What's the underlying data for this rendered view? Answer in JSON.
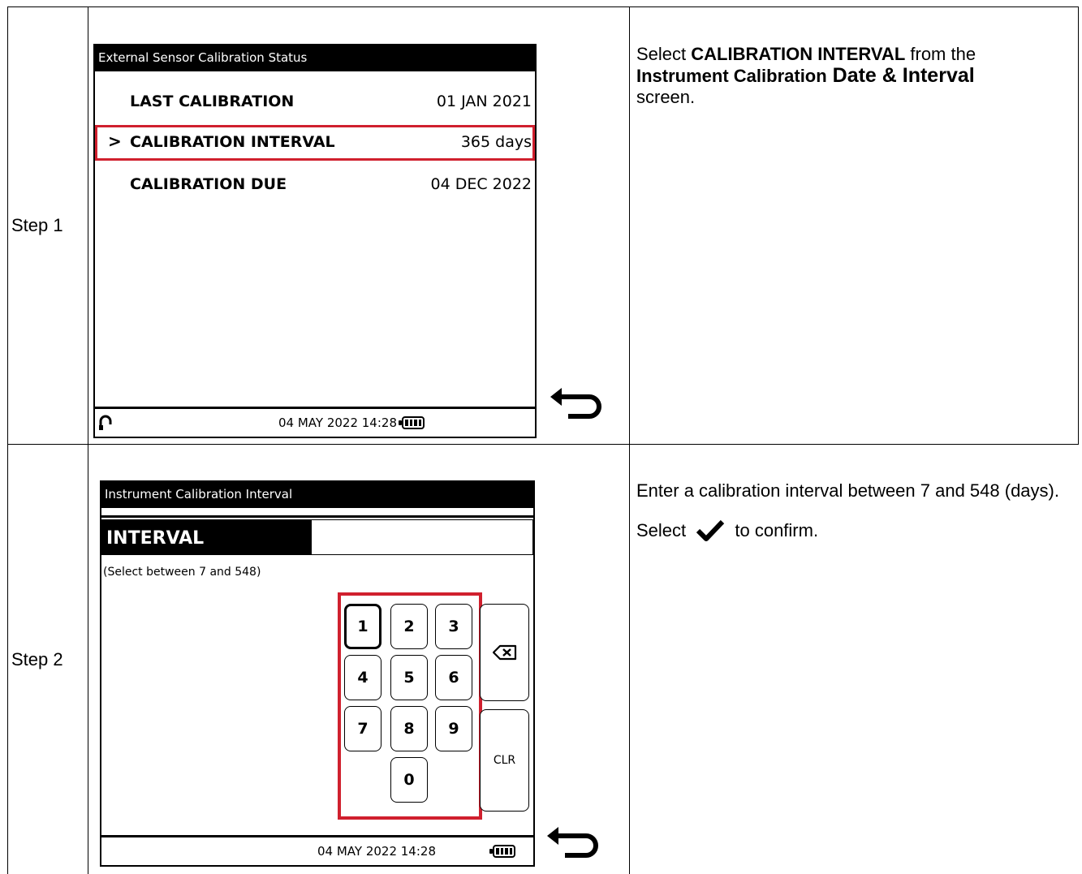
{
  "steps": [
    {
      "label": "Step 1",
      "screen": {
        "title": "External Sensor Calibration Status",
        "rows": [
          {
            "label": "LAST CALIBRATION",
            "value": "01 JAN 2021"
          },
          {
            "label": "CALIBRATION INTERVAL",
            "value": "365 days",
            "selected": true,
            "marker": ">"
          },
          {
            "label": "CALIBRATION DUE",
            "value": "04 DEC 2022"
          }
        ],
        "status": {
          "datetime": "04 MAY 2022 14:28",
          "left_icon": "headset-icon",
          "battery_icon": "battery-icon"
        }
      },
      "instruction": {
        "pre": "Select ",
        "bold1": "CALIBRATION INTERVAL",
        "mid": " from the ",
        "bold2": "Instrument Calibration",
        "bold3": " Date & Interval",
        "post": "screen."
      }
    },
    {
      "label": "Step 2",
      "screen": {
        "title": "Instrument Calibration Interval",
        "field_label": "INTERVAL",
        "hint": "(Select between 7 and 548)",
        "keys": [
          "1",
          "2",
          "3",
          "4",
          "5",
          "6",
          "7",
          "8",
          "9",
          "0"
        ],
        "backspace_icon": "backspace-icon",
        "clear_label": "CLR",
        "status": {
          "datetime": "04 MAY 2022 14:28",
          "battery_icon": "battery-icon"
        }
      },
      "instruction": {
        "line1": "Enter a calibration interval between 7 and 548 (days).",
        "select_pre": "Select ",
        "check_icon": "checkmark-icon",
        "select_post": " to confirm."
      }
    }
  ],
  "back_icon": "back-arrow-icon",
  "colors": {
    "highlight": "#d0202e"
  }
}
